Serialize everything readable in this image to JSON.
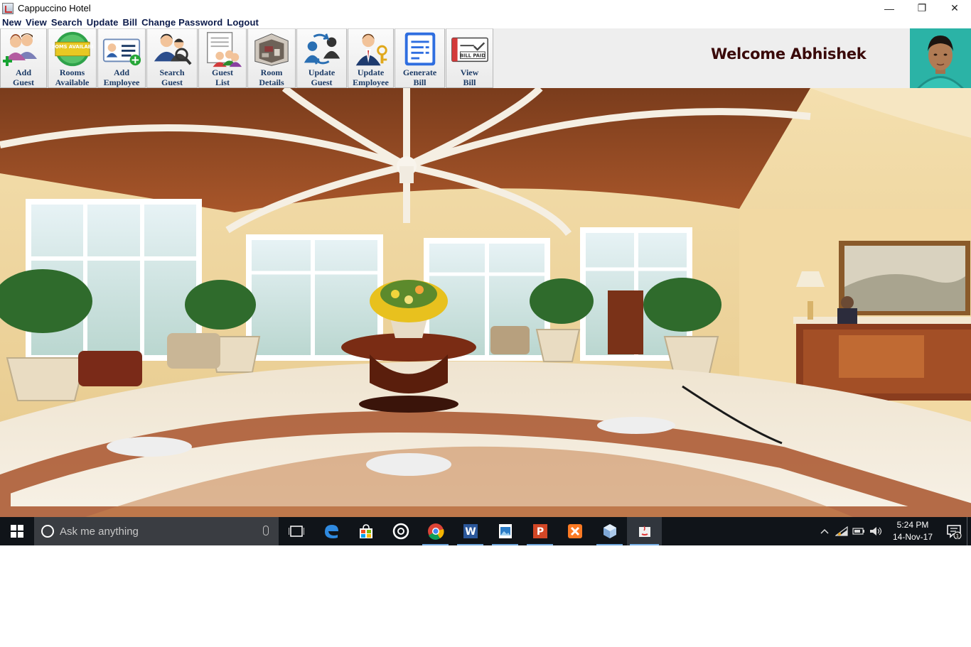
{
  "window": {
    "title": "Cappuccino Hotel",
    "minimize_glyph": "—",
    "restore_glyph": "❐",
    "close_glyph": "✕"
  },
  "menu": [
    "New",
    "View",
    "Search",
    "Update",
    "Bill",
    "Change Password",
    "Logout"
  ],
  "toolbar": {
    "buttons": [
      {
        "label_line1": "Add",
        "label_line2": "Guest",
        "icon": "add-guest-icon"
      },
      {
        "label_line1": "Rooms",
        "label_line2": "Available",
        "icon": "rooms-available-icon"
      },
      {
        "label_line1": "Add",
        "label_line2": "Employee",
        "icon": "add-employee-icon"
      },
      {
        "label_line1": "Search",
        "label_line2": "Guest",
        "icon": "search-guest-icon"
      },
      {
        "label_line1": "Guest",
        "label_line2": "List",
        "icon": "guest-list-icon"
      },
      {
        "label_line1": "Room",
        "label_line2": "Details",
        "icon": "room-details-icon"
      },
      {
        "label_line1": "Update",
        "label_line2": "Guest",
        "icon": "update-guest-icon"
      },
      {
        "label_line1": "Update",
        "label_line2": "Employee",
        "icon": "update-employee-icon"
      },
      {
        "label_line1": "Generate",
        "label_line2": "Bill",
        "icon": "generate-bill-icon"
      },
      {
        "label_line1": "View",
        "label_line2": "Bill",
        "icon": "view-bill-icon"
      }
    ],
    "rooms_badge": "ROOMS AVAILABLE",
    "bill_paid_badge": "BILL PAID"
  },
  "welcome_text": "Welcome Abhishek",
  "taskbar": {
    "search_placeholder": "Ask me anything",
    "time": "5:24 PM",
    "date": "14-Nov-17",
    "notification_count": "1",
    "apps": [
      "task-view-icon",
      "edge-icon",
      "store-icon",
      "groove-icon",
      "chrome-icon",
      "word-icon",
      "photos-icon",
      "powerpoint-icon",
      "xampp-icon",
      "virtualbox-icon",
      "java-icon"
    ]
  },
  "colors": {
    "menu_text": "#0b1a4a",
    "toolbar_label": "#1c3b66",
    "welcome_text": "#3a0a0a",
    "taskbar_bg": "#101419",
    "avatar_bg": "#2bb3a6"
  }
}
